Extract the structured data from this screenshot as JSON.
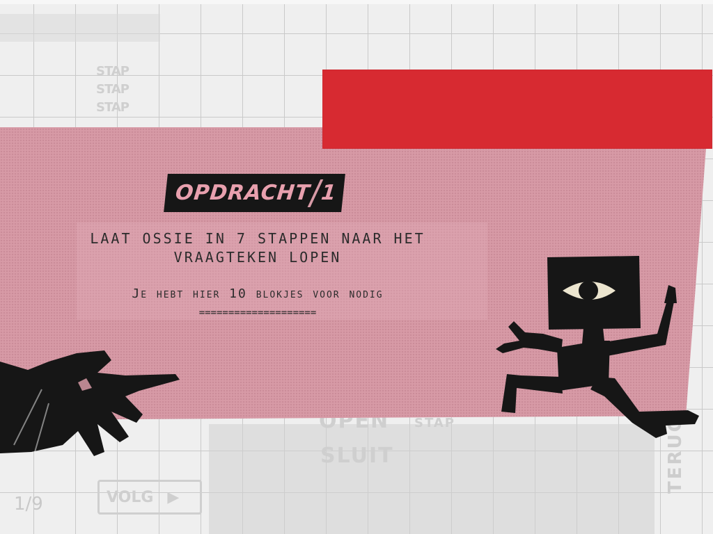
{
  "title": {
    "label": "OPDRACHT",
    "number": "1"
  },
  "instruction": {
    "line1": "LAAT OSSIE IN 7 STAPPEN NAAR HET",
    "line2": "VRAAGTEKEN LOPEN",
    "line3": "Je hebt hier 10 blokjes voor nodig",
    "underline": "===================="
  },
  "background": {
    "stap_words": [
      "STAP",
      "STAP",
      "STAP"
    ],
    "open_label": "OPEN",
    "stap_small": "STAP",
    "sluit_label": "SLUIT",
    "counter": "1/9",
    "volgende_label": "VOLG",
    "terug_label": "TERUG"
  },
  "colors": {
    "pink_panel": "#d79aa6",
    "red_banner": "#d72a31",
    "ink": "#161616"
  },
  "icons": {
    "character": "ossie-character",
    "hand": "pointing-hand"
  }
}
